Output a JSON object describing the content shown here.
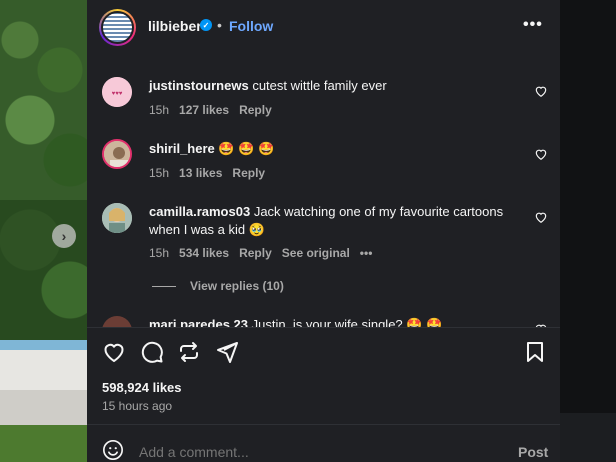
{
  "header": {
    "username": "lilbieber",
    "separator": "•",
    "follow_label": "Follow",
    "more_label": "•••"
  },
  "comments": [
    {
      "username": "justinstournews",
      "text": "cutest wittle family ever",
      "time": "15h",
      "likes": "127 likes",
      "reply": "Reply"
    },
    {
      "username": "shiril_here",
      "text": "🤩 🤩 🤩",
      "time": "15h",
      "likes": "13 likes",
      "reply": "Reply"
    },
    {
      "username": "camilla.ramos03",
      "text": "Jack watching one of my favourite cartoons when I was a kid 🥹",
      "time": "15h",
      "likes": "534 likes",
      "reply": "Reply",
      "see_original": "See original",
      "options": "•••",
      "view_replies": "View replies (10)"
    },
    {
      "username": "mari.paredes.23",
      "text": "Justin, is your wife single? 🤩 🤩"
    }
  ],
  "post": {
    "likes": "598,924 likes",
    "time_ago": "15 hours ago"
  },
  "composer": {
    "placeholder": "Add a comment...",
    "post_label": "Post"
  },
  "colors": {
    "panel": "#1f2024",
    "accent": "#6ea8ff",
    "muted": "#a8a8a8",
    "verified": "#0095f6"
  }
}
